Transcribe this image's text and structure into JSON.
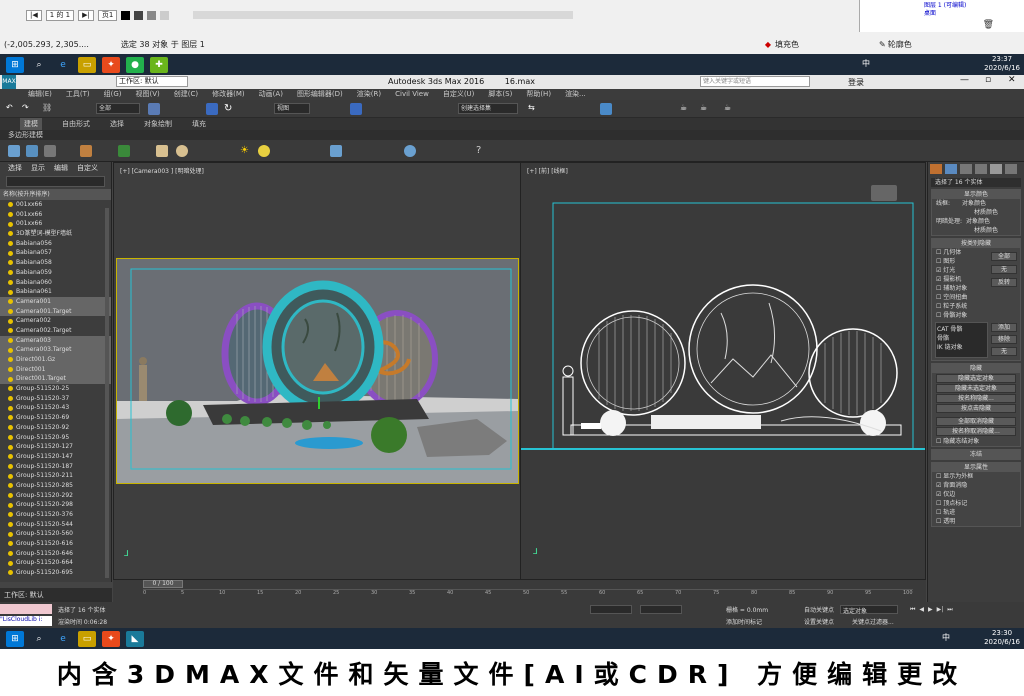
{
  "outer": {
    "page_label": "1 的 1",
    "page_tab": "页1",
    "coords": "(-2,005.293, 2,305....",
    "selection_status": "选定 38 对象 于 图层 1",
    "fill_label": "填充色",
    "outline_label": "轮廓色",
    "layers": [
      "图层 1 (可编辑)",
      "桌面"
    ]
  },
  "taskbar_top": {
    "time": "23:37",
    "date": "2020/6/16",
    "lang": "中"
  },
  "max_title": {
    "app": "Autodesk 3ds Max 2016",
    "file": "16.max",
    "workspace": "工作区: 默认",
    "search_placeholder": "键入关键字或短语",
    "login": "登录"
  },
  "menu": [
    "编辑(E)",
    "工具(T)",
    "组(G)",
    "视图(V)",
    "创建(C)",
    "修改器(M)",
    "动画(A)",
    "图形编辑器(D)",
    "渲染(R)",
    "Civil View",
    "自定义(U)",
    "脚本(S)",
    "帮助(H)",
    "渲染..."
  ],
  "toolbar": {
    "filter": "全部",
    "view": "视图",
    "selset": "创建选择集"
  },
  "ribbon": {
    "tabs": [
      "建模",
      "自由形式",
      "选择",
      "对象绘制",
      "填充"
    ],
    "sub": "多边形建模"
  },
  "explorer": {
    "tabs": [
      "选择",
      "显示",
      "编辑",
      "自定义"
    ],
    "header": "名称(按升序排序)",
    "items": [
      "001xx66",
      "001xx66",
      "001xx66",
      "3D篆塑词-模型F墙纸",
      "Babiana056",
      "Babiana057",
      "Babiana058",
      "Babiana059",
      "Babiana060",
      "Babiana061",
      "Camera001",
      "Camera001.Target",
      "Camera002",
      "Camera002.Target",
      "Camera003",
      "Camera003.Target",
      "Direct001.Gz",
      "Direct001",
      "Direct001.Target",
      "Group-511520-25",
      "Group-511520-37",
      "Group-511520-43",
      "Group-511520-69",
      "Group-511520-92",
      "Group-511520-95",
      "Group-511520-127",
      "Group-511520-147",
      "Group-511520-187",
      "Group-511520-211",
      "Group-511520-285",
      "Group-511520-292",
      "Group-511520-298",
      "Group-511520-376",
      "Group-511520-544",
      "Group-511520-560",
      "Group-511520-616",
      "Group-511520-646",
      "Group-511520-664",
      "Group-511520-695"
    ],
    "selected_rows": [
      10,
      11,
      14,
      15,
      16,
      17,
      18
    ],
    "workspace": "工作区: 默认"
  },
  "viewports": {
    "left_label": "[+] [Camera003 ] [明暗处理]",
    "right_label": "[+] [前] [线框]"
  },
  "command_panel": {
    "selection": "选择了 16 个实体",
    "display_color": {
      "title": "显示颜色",
      "wireframe": "线框:",
      "shaded": "明暗处理:",
      "opt_object": "对象颜色",
      "opt_material": "材质颜色"
    },
    "hide_by_category": {
      "title": "按类别隐藏",
      "items": [
        "几何体",
        "图形",
        "灯光",
        "摄影机",
        "辅助对象",
        "空间扭曲",
        "粒子系统",
        "骨骼对象"
      ],
      "buttons": [
        "全部",
        "无",
        "反转"
      ],
      "list": [
        "CAT 骨骼",
        "骨骼",
        "IK 链对象"
      ],
      "list_buttons": [
        "添加",
        "移除",
        "无"
      ]
    },
    "hide": {
      "title": "隐藏",
      "buttons": [
        "隐藏选定对象",
        "隐藏未选定对象",
        "按名称隐藏...",
        "按点击隐藏",
        "全部取消隐藏",
        "按名称取消隐藏...",
        "隐藏冻结对象"
      ]
    },
    "freeze_title": "冻结",
    "display_props": {
      "title": "显示属性",
      "items": [
        "显示为外框",
        "背面消隐",
        "仅边",
        "顶点标记",
        "轨迹",
        "透明"
      ]
    }
  },
  "timeline": {
    "frame": "0 / 100",
    "ticks": [
      "0",
      "5",
      "10",
      "15",
      "20",
      "25",
      "30",
      "35",
      "40",
      "45",
      "50",
      "55",
      "60",
      "65",
      "70",
      "75",
      "80",
      "85",
      "90",
      "95",
      "100"
    ]
  },
  "status": {
    "selected": "选择了 16 个实体",
    "render_time": "渲染时间 0:06:28",
    "maxscript": "\"LisCloudLib i:",
    "grid": "栅格 = 0.0mm",
    "add_time_tag": "添加时间标记",
    "auto_key": "自动关键点",
    "set_key": "设置关键点",
    "selected_filter": "选定对象",
    "key_filters": "关键点过滤器..."
  },
  "taskbar_bot": {
    "time": "23:30",
    "date": "2020/6/16",
    "lang": "中"
  },
  "caption": "内含3DMAX文件和矢量文件[AI或CDR] 方便编辑更改",
  "colors": {
    "ring_cyan": "#2fb8c4",
    "ring_purple": "#8a4fc2",
    "ring_orange": "#c67a2a",
    "viewport_frame": "#c8b400",
    "taskbar": "#1c2a3a"
  }
}
